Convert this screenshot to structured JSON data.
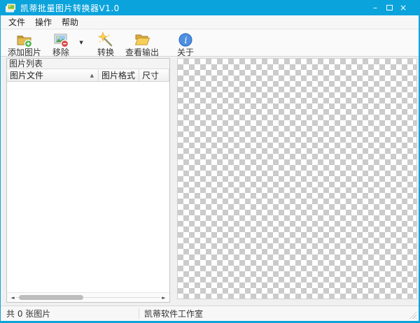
{
  "window": {
    "title": "凯蒂批量图片转换器V1.0"
  },
  "icons": {
    "minimize": "–",
    "maximize": "css-square",
    "close": "×",
    "dropdown": "▼",
    "sort_asc": "▲",
    "scroll_left": "◄",
    "scroll_right": "►"
  },
  "menu": {
    "items": [
      {
        "label": "文件"
      },
      {
        "label": "操作"
      },
      {
        "label": "帮助"
      }
    ]
  },
  "toolbar": {
    "buttons": [
      {
        "label": "添加图片",
        "icon": "add-images-icon"
      },
      {
        "label": "移除",
        "icon": "remove-image-icon",
        "has_dropdown": true
      },
      {
        "label": "转换",
        "icon": "convert-wand-icon"
      },
      {
        "label": "查看输出",
        "icon": "view-output-folder-icon"
      },
      {
        "label": "关于",
        "icon": "about-info-icon"
      }
    ]
  },
  "image_list": {
    "panel_title": "图片列表",
    "columns": [
      {
        "label": "图片文件",
        "sort": "asc"
      },
      {
        "label": "图片格式",
        "sort": null
      },
      {
        "label": "尺寸",
        "sort": null
      }
    ],
    "rows": []
  },
  "preview": {
    "content": "empty",
    "background": "transparency-checkerboard"
  },
  "status_bar": {
    "count_text": "共 0 张图片",
    "studio_text": "凯蒂软件工作室"
  },
  "colors": {
    "titlebar": "#0BA3DC",
    "window_border": "#0BA3DC",
    "checker_gray": "#CBCBCB",
    "checker_white": "#FFFFFF"
  }
}
